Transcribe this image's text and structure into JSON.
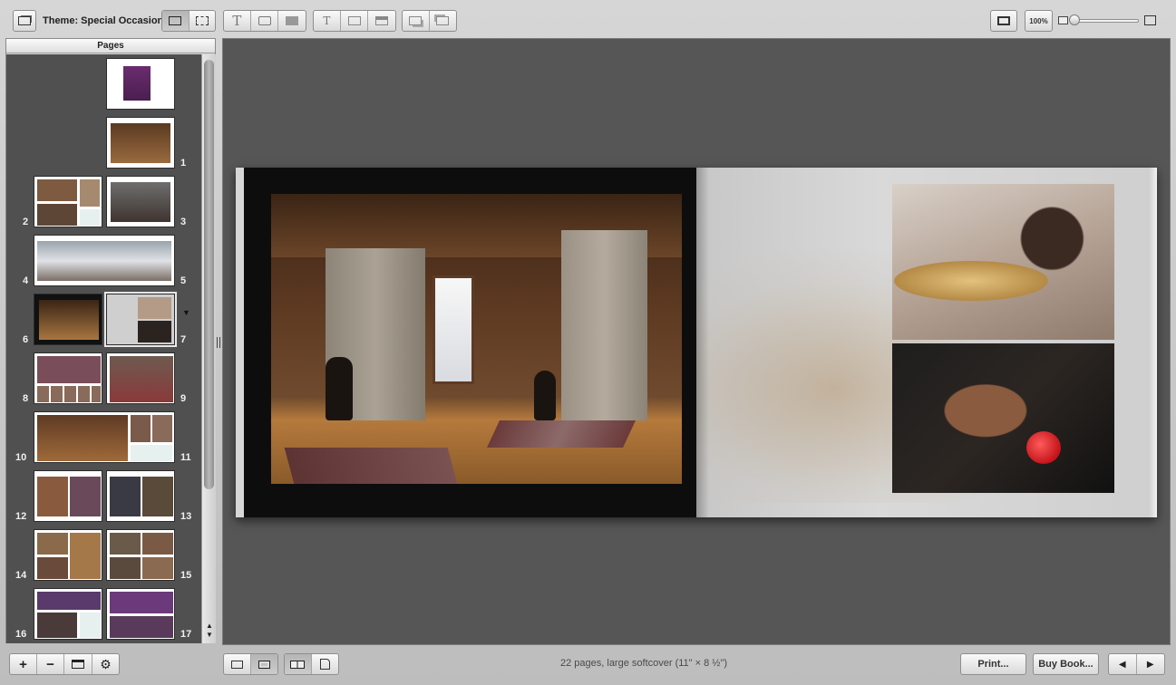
{
  "toolbar": {
    "theme_label": "Theme: Special Occasion",
    "zoom_label": "100%"
  },
  "sidebar": {
    "header": "Pages",
    "pages": [
      "1",
      "2",
      "3",
      "4",
      "5",
      "6",
      "7",
      "8",
      "9",
      "10",
      "11",
      "12",
      "13",
      "14",
      "15",
      "16",
      "17"
    ]
  },
  "status": {
    "text": "22 pages, large softcover (11\" × 8 ½\")"
  },
  "buttons": {
    "print": "Print...",
    "buy_book": "Buy Book..."
  },
  "icons": {
    "add": "+",
    "remove": "−",
    "prev": "◀",
    "next": "▶",
    "gear": "⚙",
    "text": "T",
    "scroll_up": "▲",
    "scroll_down": "▼",
    "menu_arrow": "▼"
  }
}
